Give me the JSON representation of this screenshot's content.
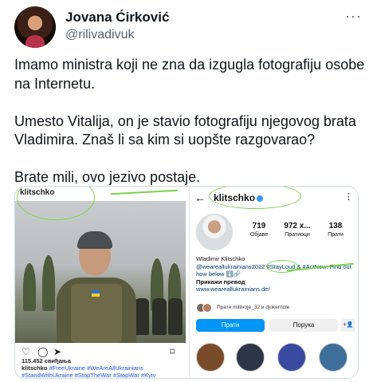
{
  "tweet": {
    "author_name": "Jovana Ćirković",
    "author_handle": "@rilivadivuk",
    "more_icon": "···",
    "paragraphs": [
      "Imamo ministra koji ne zna da izgugla fotografiju osobe na Internetu.",
      "Umesto Vitalija, on je stavio fotografiju njegovog brata Vladimira. Znaš li sa kim si uopšte razgovarao?",
      "Brate mili, ovo jezivo postaje."
    ]
  },
  "instagram_post": {
    "username": "klitschko",
    "likes": "115.452 свиђања",
    "caption_user": "klitschko",
    "caption_tags": "#FreeUkraine #WeAreAllUkrainians #StandWithUkraine #StopTheWar #StopWar #Kyiv #Standtogether #Ukraine #United",
    "icons": [
      "heart-icon",
      "comment-icon",
      "share-icon",
      "bookmark-icon"
    ]
  },
  "instagram_profile": {
    "back_icon": "←",
    "username": "klitschko",
    "more_icon": "⋮",
    "stats": [
      {
        "value": "719",
        "label": "Објаве"
      },
      {
        "value": "972 х...",
        "label": "Пратиоци"
      },
      {
        "value": "138",
        "label": "Прати"
      }
    ],
    "bio_name": "Wladimir Klitschko",
    "bio_line1": "@weareallukrainians2022 #StayLoud & #ActNow: Find out how below ⬇️🔗",
    "bio_translate": "Прикажи превод",
    "bio_link": "www.weareallukrainians.de/",
    "followed_by": "Прате millivoje_32 и djokernole",
    "follow_button": "Прати",
    "message_button": "Порука",
    "add_button": "+👤",
    "highlight_colors": [
      "#7a4b2a",
      "#2d3548",
      "#3a4aa0",
      "#3d6f9a"
    ]
  }
}
